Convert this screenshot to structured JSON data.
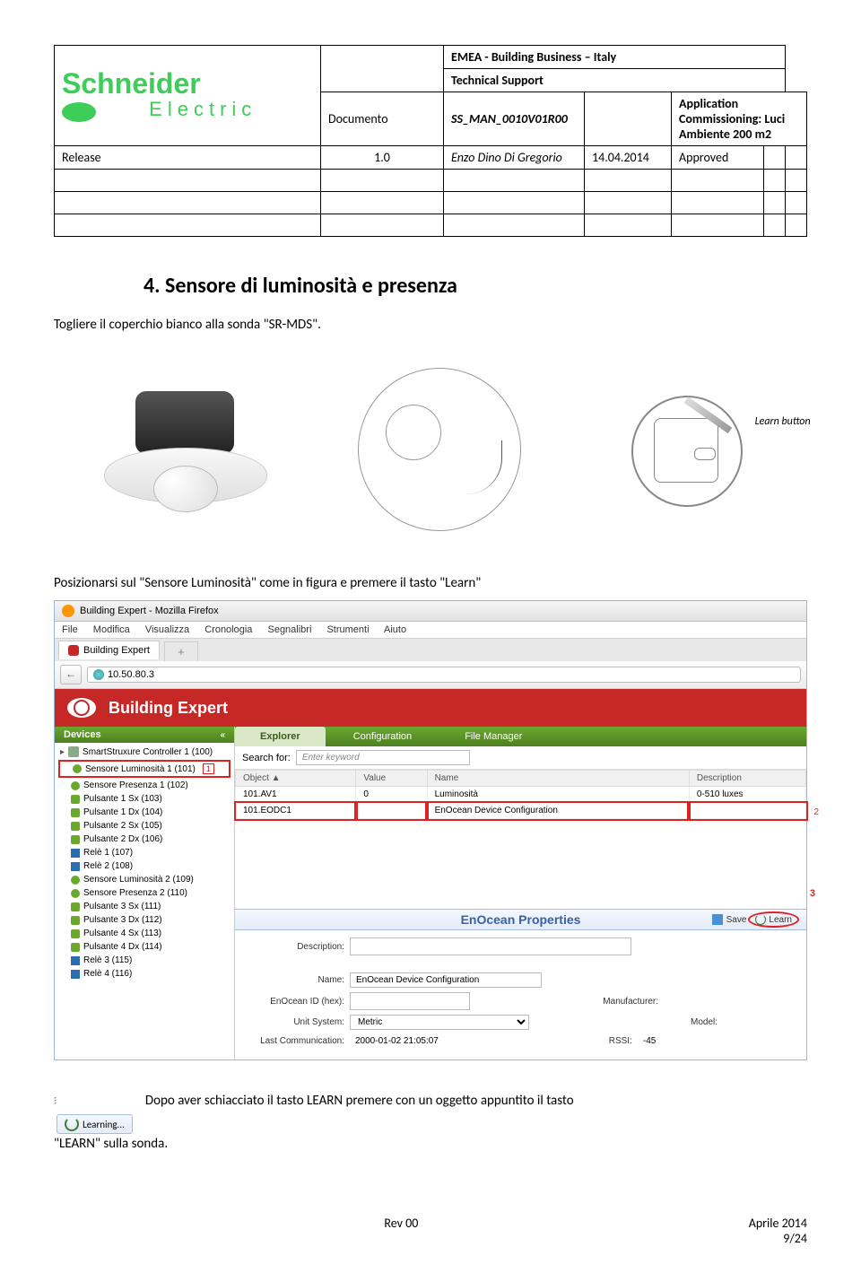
{
  "header": {
    "company_title": "EMEA - Building Business – Italy",
    "company_sub": "Technical Support",
    "doc_label": "Documento",
    "doc_code": "SS_MAN_0010V01R00",
    "app_title": "Application Commissioning: Luci Ambiente 200 m2",
    "release_label": "Release",
    "release_version": "1.0",
    "author": "Enzo Dino Di Gregorio",
    "date": "14.04.2014",
    "status": "Approved",
    "logo_main": "Schneider",
    "logo_sub": "Electric"
  },
  "section": {
    "number_title": "4. Sensore di luminosità e presenza",
    "intro": "Togliere il coperchio bianco alla sonda \"SR-MDS\".",
    "learn_btn_label": "Learn button",
    "instruction": "Posizionarsi sul \"Sensore Luminosità\" come in figura e premere il tasto \"Learn\""
  },
  "firefox": {
    "window_title": "Building Expert - Mozilla Firefox",
    "menus": [
      "File",
      "Modifica",
      "Visualizza",
      "Cronologia",
      "Segnalibri",
      "Strumenti",
      "Aiuto"
    ],
    "tab_label": "Building Expert",
    "address": "10.50.80.3"
  },
  "app": {
    "title": "Building Expert",
    "devices_header": "Devices",
    "tabs": [
      "Explorer",
      "Configuration",
      "File Manager"
    ],
    "search_label": "Search for:",
    "search_placeholder": "Enter keyword",
    "columns": [
      "Object ▲",
      "Value",
      "Name",
      "Description"
    ],
    "rows": [
      {
        "obj": "101.AV1",
        "value": "0",
        "name": "Luminosità",
        "desc": "0-510 luxes"
      },
      {
        "obj": "101.EODC1",
        "value": "",
        "name": "EnOcean Device Configuration",
        "desc": ""
      }
    ],
    "devices": [
      {
        "label": "SmartStruxure Controller 1 (100)",
        "type": "root"
      },
      {
        "label": "Sensore Luminosità 1 (101)",
        "type": "cloud",
        "selected": true,
        "marker": "1"
      },
      {
        "label": "Sensore Presenza 1 (102)",
        "type": "cloud"
      },
      {
        "label": "Pulsante 1 Sx (103)",
        "type": "node"
      },
      {
        "label": "Pulsante 1 Dx (104)",
        "type": "node"
      },
      {
        "label": "Pulsante 2 Sx (105)",
        "type": "node"
      },
      {
        "label": "Pulsante 2 Dx (106)",
        "type": "node"
      },
      {
        "label": "Relè 1 (107)",
        "type": "relay"
      },
      {
        "label": "Relè 2 (108)",
        "type": "relay"
      },
      {
        "label": "Sensore Luminosità 2 (109)",
        "type": "cloud"
      },
      {
        "label": "Sensore Presenza 2 (110)",
        "type": "cloud"
      },
      {
        "label": "Pulsante 3 Sx (111)",
        "type": "node"
      },
      {
        "label": "Pulsante 3 Dx (112)",
        "type": "node"
      },
      {
        "label": "Pulsante 4 Sx (113)",
        "type": "node"
      },
      {
        "label": "Pulsante 4 Dx (114)",
        "type": "node"
      },
      {
        "label": "Relè 3 (115)",
        "type": "relay"
      },
      {
        "label": "Relè 4 (116)",
        "type": "relay"
      }
    ],
    "enocean_header": "EnOcean Properties",
    "save_label": "Save",
    "learn_label": "Learn",
    "props": {
      "description_label": "Description:",
      "name_label": "Name:",
      "name_value": "EnOcean Device Configuration",
      "enoceanid_label": "EnOcean ID (hex):",
      "manufacturer_label": "Manufacturer:",
      "unitsystem_label": "Unit System:",
      "unitsystem_value": "Metric",
      "model_label": "Model:",
      "lastcomm_label": "Last Communication:",
      "lastcomm_value": "2000-01-02 21:05:07",
      "rssi_label": "RSSI:",
      "rssi_value": "-45"
    },
    "markers": {
      "row": "2",
      "learn": "3"
    }
  },
  "learning": {
    "button_label": "Learning...",
    "after_text": "Dopo aver schiacciato il tasto LEARN premere con un oggetto appuntito il tasto",
    "after_text2": "\"LEARN\" sulla sonda."
  },
  "footer": {
    "rev": "Rev 00",
    "date": "Aprile 2014",
    "page": "9/24"
  }
}
